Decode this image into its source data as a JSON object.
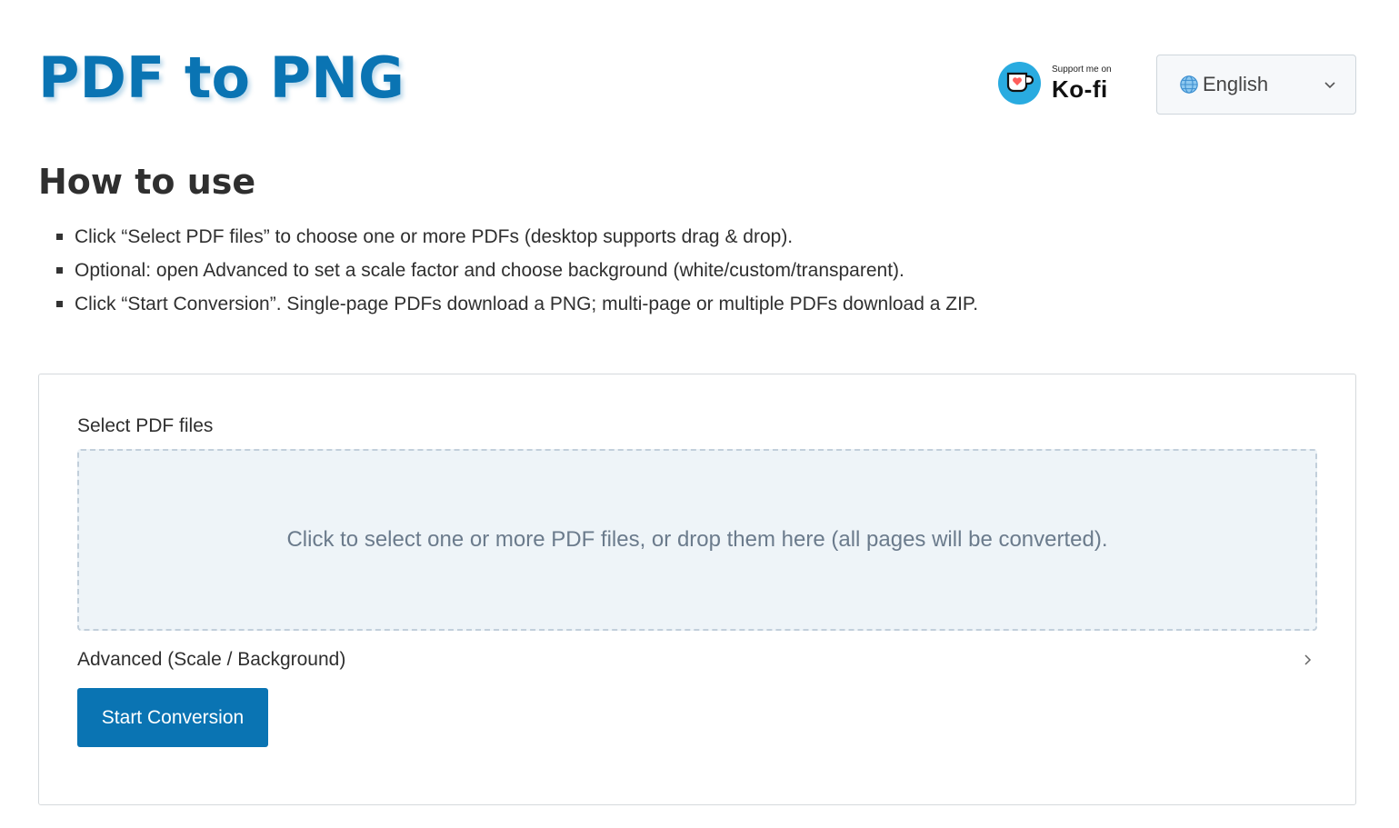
{
  "header": {
    "title": "PDF to PNG",
    "kofi": {
      "small": "Support me on",
      "big": "Ko-fi",
      "icon": "kofi-cup-icon"
    },
    "language": {
      "selected": "English",
      "icon": "globe-icon"
    }
  },
  "howto": {
    "title": "How to use",
    "items": [
      "Click “Select PDF files” to choose one or more PDFs (desktop supports drag & drop).",
      "Optional: open Advanced to set a scale factor and choose background (white/custom/transparent).",
      "Click “Start Conversion”. Single-page PDFs download a PNG; multi-page or multiple PDFs download a ZIP."
    ]
  },
  "converter": {
    "select_label": "Select PDF files",
    "dropzone_text": "Click to select one or more PDF files, or drop them here (all pages will be converted).",
    "advanced_label": "Advanced (Scale / Background)",
    "start_label": "Start Conversion"
  },
  "colors": {
    "accent": "#0a74b3",
    "kofi_blue": "#29abe0",
    "dropzone_bg": "#eef4f8"
  }
}
